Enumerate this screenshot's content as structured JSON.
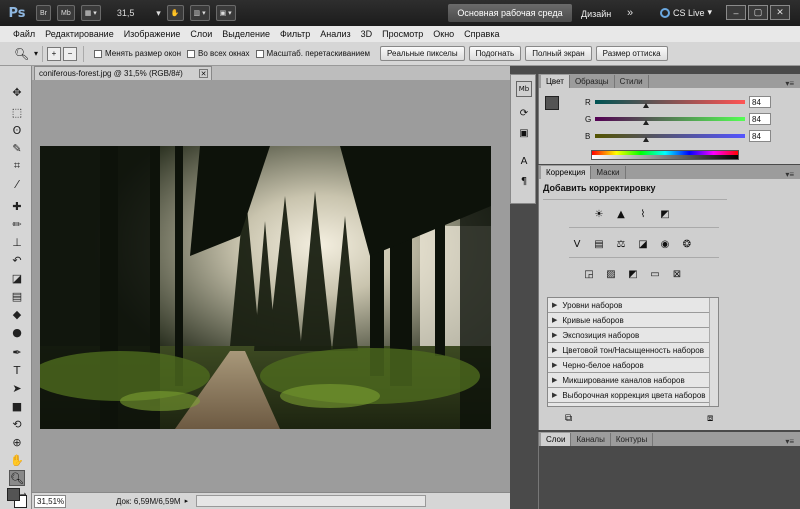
{
  "app": {
    "name": "Ps"
  },
  "titlebar": {
    "br": "Br",
    "mb": "Mb",
    "zoom_value": "31,5",
    "workspace_active": "Основная рабочая среда",
    "workspace_design": "Дизайн",
    "more": "»",
    "cs_live": "CS Live"
  },
  "menu": [
    "Файл",
    "Редактирование",
    "Изображение",
    "Слои",
    "Выделение",
    "Фильтр",
    "Анализ",
    "3D",
    "Просмотр",
    "Окно",
    "Справка"
  ],
  "options": {
    "resize_windows": "Менять размер окон",
    "all_windows": "Во всех окнах",
    "scrubby_zoom": "Масштаб. перетаскиванием",
    "actual_pixels": "Реальные пикселы",
    "fit_screen": "Подогнать",
    "fill_screen": "Полный экран",
    "print_size": "Размер оттиска"
  },
  "document": {
    "tab_title": "coniferous-forest.jpg @ 31,5% (RGB/8#)",
    "zoom": "31,51%",
    "doc_size": "Док: 6,59M/6,59M"
  },
  "color_panel": {
    "tabs": [
      "Цвет",
      "Образцы",
      "Стили"
    ],
    "r_label": "R",
    "g_label": "G",
    "b_label": "B",
    "r_value": "84",
    "g_value": "84",
    "b_value": "84"
  },
  "adjust_panel": {
    "tabs": [
      "Коррекция",
      "Маски"
    ],
    "title": "Добавить корректировку",
    "presets": [
      "Уровни наборов",
      "Кривые наборов",
      "Экспозиция наборов",
      "Цветовой тон/Насыщенность наборов",
      "Черно-белое наборов",
      "Микширование каналов наборов",
      "Выборочная коррекция цвета наборов"
    ]
  },
  "layers_panel": {
    "tabs": [
      "Слои",
      "Каналы",
      "Контуры"
    ]
  },
  "colors": {
    "foreground": "#545454",
    "accent": "#8fb7e0"
  }
}
